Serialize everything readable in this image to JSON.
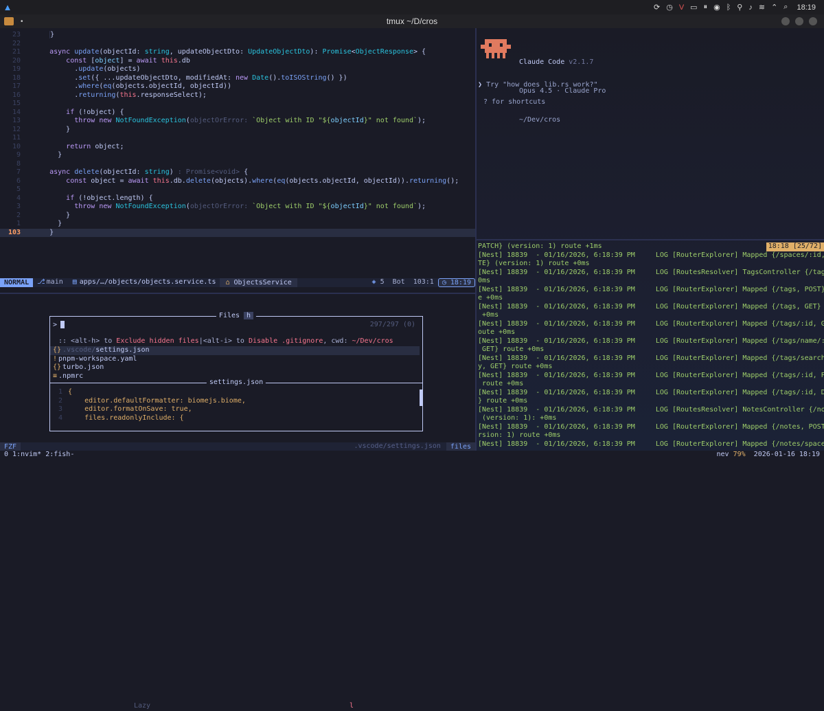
{
  "system_bar": {
    "clock": "18:19",
    "tray_icons": [
      "refresh-icon",
      "timer-icon",
      "vpn-icon",
      "clipboard-icon",
      "pause-icon",
      "volume-icon",
      "bluetooth-icon",
      "location-icon",
      "mic-icon",
      "wifi-icon",
      "chevron-up-icon",
      "search-icon"
    ]
  },
  "window": {
    "title": "tmux ~/D/cros",
    "dot": "•"
  },
  "editor": {
    "lines": [
      {
        "n": "23",
        "html": "<span class=\"guide\"></span>}"
      },
      {
        "n": "22",
        "html": ""
      },
      {
        "n": "21",
        "html": "<span class=\"kw\">async</span> <span class=\"fn\">update</span>(objectId: <span class=\"ty\">string</span>, updateObjectDto: <span class=\"ty\">UpdateObjectDto</span>): <span class=\"ty\">Promise</span>&lt;<span class=\"ty\">ObjectResponse</span>&gt; {"
      },
      {
        "n": "20",
        "html": "    <span class=\"kw\">const</span> [<span class=\"pr\">object</span>] = <span class=\"kw\">await</span> <span class=\"this\">this</span>.db"
      },
      {
        "n": "19",
        "html": "      .<span class=\"fn\">update</span>(objects)"
      },
      {
        "n": "18",
        "html": "      .<span class=\"fn\">set</span>({ ...updateObjectDto, modifiedAt: <span class=\"kw\">new</span> <span class=\"ty\">Date</span>().<span class=\"fn\">toISOString</span>() })"
      },
      {
        "n": "17",
        "html": "      .<span class=\"fn\">where</span>(<span class=\"fn\">eq</span>(objects.objectId, objectId))"
      },
      {
        "n": "16",
        "html": "      .<span class=\"fn\">returning</span>(<span class=\"this\">this</span>.responseSelect);"
      },
      {
        "n": "15",
        "html": ""
      },
      {
        "n": "14",
        "html": "    <span class=\"kw\">if</span> (!object) {"
      },
      {
        "n": "13",
        "html": "      <span class=\"kw\">throw new</span> <span class=\"ty\">NotFoundException</span>(<span class=\"hint\">objectOrError:</span> <span class=\"str\">`Object with ID \"${<span class=\"pr\">objectId</span>}\" not found`</span>);"
      },
      {
        "n": "12",
        "html": "    }"
      },
      {
        "n": "11",
        "html": ""
      },
      {
        "n": "10",
        "html": "    <span class=\"kw\">return</span> object;"
      },
      {
        "n": "9",
        "html": "  }"
      },
      {
        "n": "8",
        "html": ""
      },
      {
        "n": "7",
        "html": "<span class=\"kw\">async</span> <span class=\"fn\">delete</span>(objectId: <span class=\"ty\">string</span>)<span class=\"hint\"> : Promise&lt;void&gt;</span> {"
      },
      {
        "n": "6",
        "html": "    <span class=\"kw\">const</span> object = <span class=\"kw\">await</span> <span class=\"this\">this</span>.db.<span class=\"fn\">delete</span>(objects).<span class=\"fn\">where</span>(<span class=\"fn\">eq</span>(objects.objectId, objectId)).<span class=\"fn\">returning</span>();"
      },
      {
        "n": "5",
        "html": ""
      },
      {
        "n": "4",
        "html": "    <span class=\"kw\">if</span> (!object.length) {"
      },
      {
        "n": "3",
        "html": "      <span class=\"kw\">throw new</span> <span class=\"ty\">NotFoundException</span>(<span class=\"hint\">objectOrError:</span> <span class=\"str\">`Object with ID \"${<span class=\"pr\">objectId</span>}\" not found`</span>);"
      },
      {
        "n": "2",
        "html": "    }"
      },
      {
        "n": "1",
        "html": "  }"
      },
      {
        "n": "103",
        "html": "}",
        "current": true
      }
    ]
  },
  "statusline": {
    "mode": "NORMAL",
    "branch": "main",
    "file": "apps/…/objects/objects.service.ts",
    "symbol": "ObjectsService",
    "diagnostics": "5",
    "position": "Bot  103:1",
    "time": "18:19"
  },
  "fzf": {
    "title": "Files",
    "title_key": "h",
    "query": "",
    "count": "297/297 (0)",
    "header_prefix": ":: <alt-h> to ",
    "header_a": "Exclude hidden files",
    "header_mid": "|<alt-i> to ",
    "header_b": "Disable .gitignore",
    "header_cwd_label": ", cwd: ",
    "header_cwd": "~/Dev/cros",
    "items": [
      {
        "icon": "{}",
        "dir": ".vscode/",
        "name": "settings.json",
        "selected": true
      },
      {
        "icon": "!",
        "dir": "",
        "name": "pnpm-workspace.yaml"
      },
      {
        "icon": "{}",
        "dir": "",
        "name": "turbo.json"
      },
      {
        "icon": "≡",
        "dir": "",
        "name": ".npmrc"
      }
    ],
    "preview_title": "settings.json",
    "preview": [
      {
        "n": "1",
        "t": "{"
      },
      {
        "n": "2",
        "t": "    editor.defaultFormatter: biomejs.biome,"
      },
      {
        "n": "3",
        "t": "    editor.formatOnSave: true,"
      },
      {
        "n": "4",
        "t": "    files.readonlyInclude: {"
      }
    ],
    "lazy": "Lazy",
    "lazy_key": "l"
  },
  "fzfline": {
    "tag": "FZF",
    "path": ".vscode/settings.json",
    "filetype": "files"
  },
  "claude": {
    "name": "Claude Code",
    "version": "v2.1.7",
    "model": "Opus 4.5 · Claude Pro",
    "cwd": "~/Dev/cros",
    "prompt_char": "❯",
    "placeholder": "Try \"how does lib.rs work?\"",
    "hint": "? for shortcuts"
  },
  "logs": {
    "badge": "18:18 [25/72]",
    "lines": [
      "PATCH} (version: 1) route +1ms",
      "[Nest] 18839  - 01/16/2026, 6:18:39 PM     LOG [RouterExplorer] Mapped {/spaces/:id, DELE",
      "TE} (version: 1) route +0ms",
      "[Nest] 18839  - 01/16/2026, 6:18:39 PM     LOG [RoutesResolver] TagsController {/tags}: +",
      "0ms",
      "[Nest] 18839  - 01/16/2026, 6:18:39 PM     LOG [RouterExplorer] Mapped {/tags, POST} rout",
      "e +0ms",
      "[Nest] 18839  - 01/16/2026, 6:18:39 PM     LOG [RouterExplorer] Mapped {/tags, GET} route",
      " +0ms",
      "[Nest] 18839  - 01/16/2026, 6:18:39 PM     LOG [RouterExplorer] Mapped {/tags/:id, GET} r",
      "oute +0ms",
      "[Nest] 18839  - 01/16/2026, 6:18:39 PM     LOG [RouterExplorer] Mapped {/tags/name/:name,",
      " GET} route +0ms",
      "[Nest] 18839  - 01/16/2026, 6:18:39 PM     LOG [RouterExplorer] Mapped {/tags/search/:quer",
      "y, GET} route +0ms",
      "[Nest] 18839  - 01/16/2026, 6:18:39 PM     LOG [RouterExplorer] Mapped {/tags/:id, PATCH}",
      " route +0ms",
      "[Nest] 18839  - 01/16/2026, 6:18:39 PM     LOG [RouterExplorer] Mapped {/tags/:id, DELETE",
      "} route +0ms",
      "[Nest] 18839  - 01/16/2026, 6:18:39 PM     LOG [RoutesResolver] NotesController {/notes}",
      " (version: 1): +0ms",
      "[Nest] 18839  - 01/16/2026, 6:18:39 PM     LOG [RouterExplorer] Mapped {/notes, POST} (ve",
      "rsion: 1) route +0ms",
      "[Nest] 18839  - 01/16/2026, 6:18:39 PM     LOG [RouterExplorer] Mapped {/notes/space/:sp"
    ]
  },
  "tmux": {
    "windows": "0 1:nvim* 2:fish-",
    "host": "nev",
    "battery": "79%",
    "datetime": "2026-01-16 18:19"
  }
}
